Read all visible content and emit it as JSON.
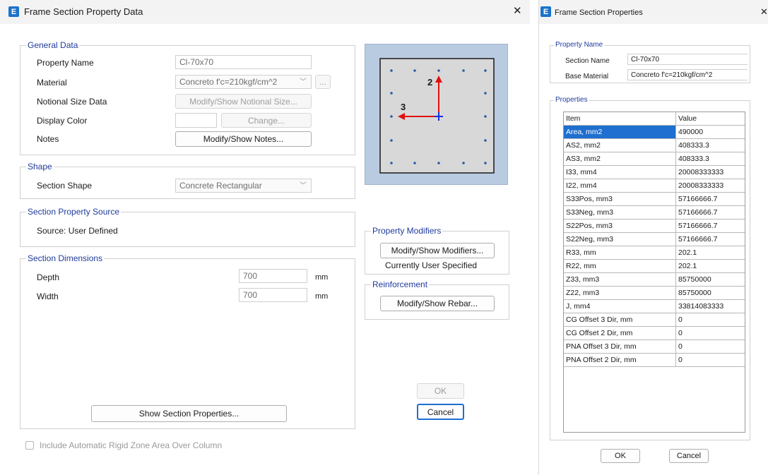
{
  "left": {
    "title": "Frame Section Property Data",
    "close": "✕",
    "general": {
      "legend": "General Data",
      "property_name_label": "Property Name",
      "property_name_value": "Cl-70x70",
      "material_label": "Material",
      "material_value": "Concreto f'c=210kgf/cm^2",
      "material_more": "...",
      "notional_label": "Notional Size Data",
      "notional_button": "Modify/Show Notional Size...",
      "display_color_label": "Display Color",
      "change_button": "Change...",
      "notes_label": "Notes",
      "notes_button": "Modify/Show Notes..."
    },
    "shape": {
      "legend": "Shape",
      "section_shape_label": "Section Shape",
      "section_shape_value": "Concrete Rectangular"
    },
    "source": {
      "legend": "Section Property Source",
      "text": "Source:  User Defined"
    },
    "dimensions": {
      "legend": "Section Dimensions",
      "depth_label": "Depth",
      "depth_value": "700",
      "depth_unit": "mm",
      "width_label": "Width",
      "width_value": "700",
      "width_unit": "mm"
    },
    "preview": {
      "axis2": "2",
      "axis3": "3"
    },
    "modifiers": {
      "legend": "Property Modifiers",
      "button": "Modify/Show Modifiers...",
      "status": "Currently User Specified"
    },
    "reinforcement": {
      "legend": "Reinforcement",
      "button": "Modify/Show Rebar..."
    },
    "show_props_button": "Show Section Properties...",
    "ok": "OK",
    "cancel": "Cancel",
    "rigid_zone": "Include Automatic Rigid Zone Area Over Column"
  },
  "right": {
    "title": "Frame Section Properties",
    "close": "✕",
    "property_name_legend": "Property Name",
    "section_name_label": "Section Name",
    "section_name_value": "Cl-70x70",
    "base_material_label": "Base Material",
    "base_material_value": "Concreto f'c=210kgf/cm^2",
    "properties_legend": "Properties",
    "columns": [
      "Item",
      "Value"
    ],
    "rows": [
      {
        "item": "Area, mm2",
        "value": "490000"
      },
      {
        "item": "AS2, mm2",
        "value": "408333.3"
      },
      {
        "item": "AS3, mm2",
        "value": "408333.3"
      },
      {
        "item": "I33, mm4",
        "value": "20008333333"
      },
      {
        "item": "I22, mm4",
        "value": "20008333333"
      },
      {
        "item": "S33Pos, mm3",
        "value": "57166666.7"
      },
      {
        "item": "S33Neg, mm3",
        "value": "57166666.7"
      },
      {
        "item": "S22Pos, mm3",
        "value": "57166666.7"
      },
      {
        "item": "S22Neg, mm3",
        "value": "57166666.7"
      },
      {
        "item": "R33, mm",
        "value": "202.1"
      },
      {
        "item": "R22, mm",
        "value": "202.1"
      },
      {
        "item": "Z33, mm3",
        "value": "85750000"
      },
      {
        "item": "Z22, mm3",
        "value": "85750000"
      },
      {
        "item": "J, mm4",
        "value": "33814083333"
      },
      {
        "item": "CG Offset 3 Dir, mm",
        "value": "0"
      },
      {
        "item": "CG Offset 2 Dir, mm",
        "value": "0"
      },
      {
        "item": "PNA Offset 3 Dir, mm",
        "value": "0"
      },
      {
        "item": "PNA Offset 2 Dir, mm",
        "value": "0"
      }
    ],
    "ok": "OK",
    "cancel": "Cancel"
  },
  "colors": {
    "accent": "#1e6fd0",
    "legend_text": "#1f3b9a",
    "preview_bg": "#b9cbe0",
    "selected_row": "#1e6fd0"
  }
}
